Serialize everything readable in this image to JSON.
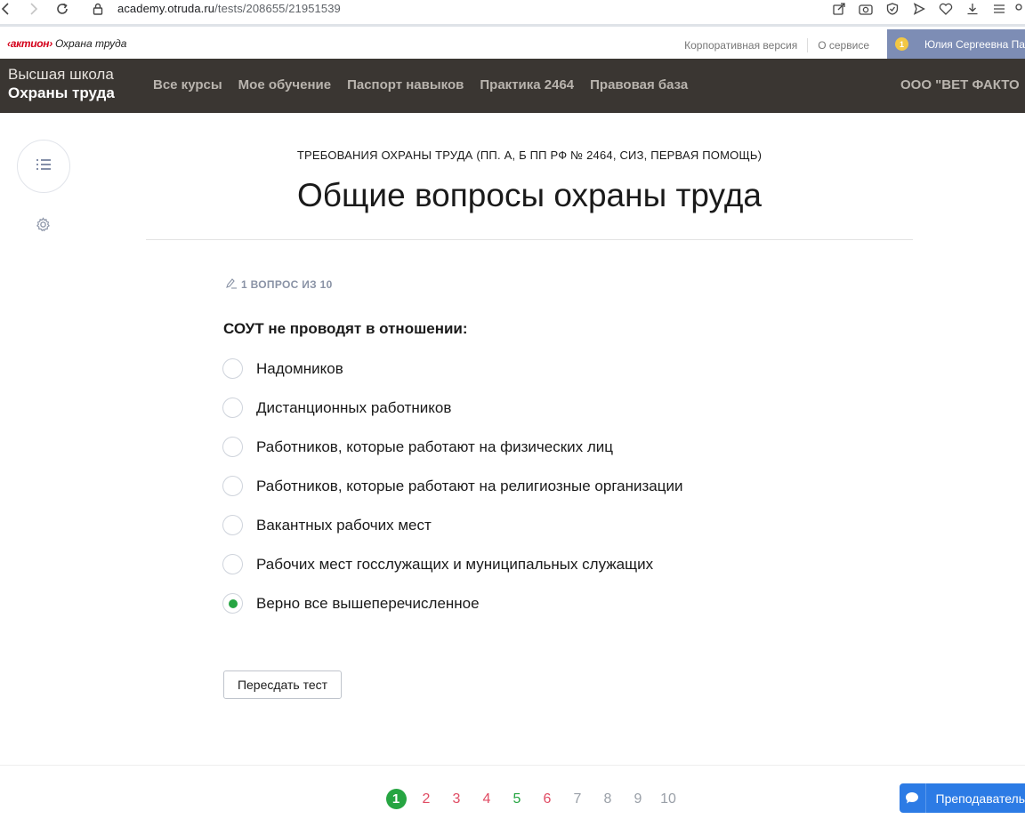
{
  "browser": {
    "url_host": "academy.otruda.ru",
    "url_path": "/tests/208655/21951539"
  },
  "topbar": {
    "brand_aktion": "‹актион›",
    "brand_product": "Охрана труда",
    "corporate_link": "Корпоративная версия",
    "about_link": "О сервисе",
    "notifications_count": "1",
    "user_name": "Юлия Сергеевна Па"
  },
  "nav": {
    "school_line1": "Высшая школа",
    "school_line2": "Охраны труда",
    "items": [
      {
        "label": "Все курсы"
      },
      {
        "label": "Мое обучение"
      },
      {
        "label": "Паспорт навыков"
      },
      {
        "label": "Практика 2464"
      },
      {
        "label": "Правовая база"
      }
    ],
    "organization": "ООО \"ВЕТ ФАКТО"
  },
  "header": {
    "course_title": "ТРЕБОВАНИЯ ОХРАНЫ ТРУДА (ПП. А, Б ПП РФ № 2464, СИЗ, ПЕРВАЯ ПОМОЩЬ)",
    "lesson_title": "Общие вопросы охраны труда"
  },
  "question": {
    "counter": "1 ВОПРОС ИЗ 10",
    "text": "СОУТ не проводят в отношении:",
    "options": [
      {
        "label": "Надомников",
        "selected": false
      },
      {
        "label": "Дистанционных работников",
        "selected": false
      },
      {
        "label": "Работников, которые работают на физических лиц",
        "selected": false
      },
      {
        "label": "Работников, которые работают на религиозные организации",
        "selected": false
      },
      {
        "label": "Вакантных рабочих мест",
        "selected": false
      },
      {
        "label": "Рабочих мест госслужащих и муниципальных служащих",
        "selected": false
      },
      {
        "label": "Верно все вышеперечисленное",
        "selected": true
      }
    ],
    "retake_button": "Пересдать тест"
  },
  "pagination": {
    "pages": [
      {
        "label": "1",
        "state": "current"
      },
      {
        "label": "2",
        "state": "wrong"
      },
      {
        "label": "3",
        "state": "wrong"
      },
      {
        "label": "4",
        "state": "wrong"
      },
      {
        "label": "5",
        "state": "right"
      },
      {
        "label": "6",
        "state": "wrong"
      },
      {
        "label": "7",
        "state": "neutral"
      },
      {
        "label": "8",
        "state": "neutral"
      },
      {
        "label": "9",
        "state": "neutral"
      },
      {
        "label": "10",
        "state": "neutral"
      }
    ]
  },
  "tutor_button": "Преподаватель",
  "colors": {
    "accent_green": "#26a542",
    "wrong_red": "#e04b63",
    "nav_bg": "#3a3632",
    "tutor_blue": "#2c7be5",
    "brand_red": "#d4001a"
  },
  "icons": {
    "back": "chevron-left-icon",
    "forward": "chevron-right-icon",
    "reload": "reload-icon",
    "lock": "lock-icon",
    "menu": "list-icon",
    "settings": "gear-icon",
    "pencil": "pencil-icon",
    "chat": "chat-bubble-icon"
  }
}
